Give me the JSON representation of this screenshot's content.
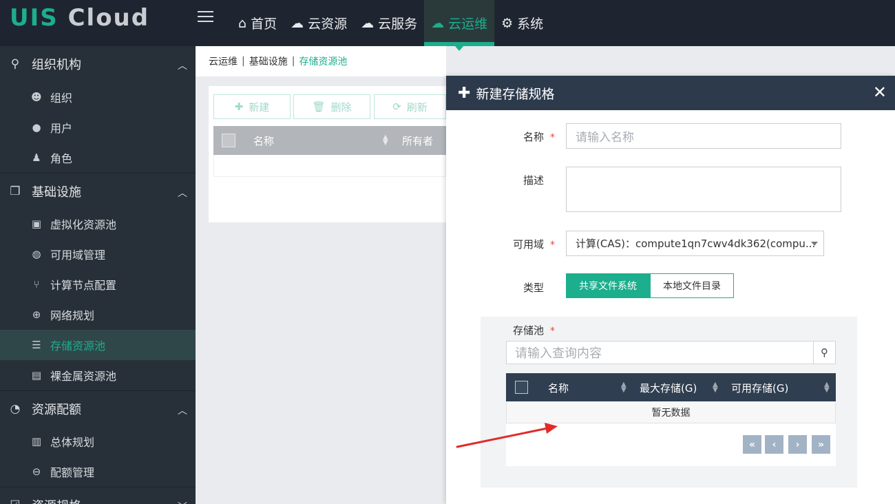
{
  "app": {
    "logo_a": "UIS",
    "logo_b": "Cloud"
  },
  "topnav": {
    "items": [
      {
        "label": "首页",
        "icon": "home-icon"
      },
      {
        "label": "云资源",
        "icon": "cloud-resource-icon"
      },
      {
        "label": "云服务",
        "icon": "cloud-service-icon"
      },
      {
        "label": "云运维",
        "icon": "cloud-ops-icon",
        "active": true
      },
      {
        "label": "系统",
        "icon": "gear-icon"
      }
    ]
  },
  "sidebar": {
    "groups": [
      {
        "label": "组织机构",
        "items": [
          "组织",
          "用户",
          "角色"
        ]
      },
      {
        "label": "基础设施",
        "items": [
          "虚拟化资源池",
          "可用域管理",
          "计算节点配置",
          "网络规划",
          "存储资源池",
          "裸金属资源池"
        ],
        "active_item": "存储资源池"
      },
      {
        "label": "资源配额",
        "items": [
          "总体规划",
          "配额管理"
        ]
      },
      {
        "label": "资源规格",
        "items": []
      }
    ]
  },
  "breadcrumb": {
    "a": "云运维",
    "b": "基础设施",
    "c": "存储资源池"
  },
  "toolbar": {
    "new": "新建",
    "delete": "删除",
    "refresh": "刷新"
  },
  "main_table": {
    "col_name": "名称",
    "col_owner": "所有者"
  },
  "drawer": {
    "title": "新建存储规格",
    "name_label": "名称",
    "name_placeholder": "请输入名称",
    "desc_label": "描述",
    "zone_label": "可用域",
    "zone_value": "计算(CAS)：compute1qn7cwv4dk362(compu...",
    "type_label": "类型",
    "type_options": [
      "共享文件系统",
      "本地文件目录"
    ],
    "pool_label": "存储池",
    "pool_search_placeholder": "请输入查询内容",
    "pool_cols": [
      "名称",
      "最大存储(G)",
      "可用存储(G)"
    ],
    "pool_empty": "暂无数据",
    "pager": [
      "«",
      "‹",
      "›",
      "»"
    ]
  },
  "colors": {
    "accent": "#1cae8d",
    "topbar": "#1f2530",
    "sidebar": "#273038",
    "drawer_head": "#2c3a4c",
    "annotation_arrow": "#e02b2b"
  }
}
